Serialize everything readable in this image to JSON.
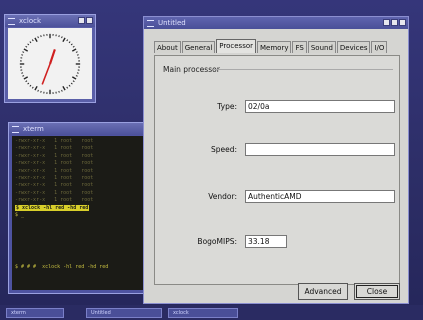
{
  "xclock": {
    "title": "xclock"
  },
  "xterm": {
    "title": "xterm",
    "lines": [
      "-rwxr-xr-x   1 root   root",
      "-rwxr-xr-x   1 root   root",
      "-rwxr-xr-x   1 root   root",
      "-rwxr-xr-x   1 root   root",
      "-rwxr-xr-x   1 root   root",
      "-rwxr-xr-x   1 root   root",
      "-rwxr-xr-x   1 root   root",
      "-rwxr-xr-x   1 root   root",
      "-rwxr-xr-x   1 root   root"
    ],
    "command": "$ xclock -hl red -hd red",
    "cursor": "$ _",
    "bottom_line": "$ # # #  xclock -hl red -hd red"
  },
  "dialog": {
    "title": "Untitled",
    "tabs": [
      "About",
      "General",
      "Processor",
      "Memory",
      "FS",
      "Sound",
      "Devices",
      "I/O"
    ],
    "active_tab": "Processor",
    "group_title": "Main processor",
    "fields": [
      {
        "label": "Type:",
        "value": "02/0a"
      },
      {
        "label": "Speed:",
        "value": ""
      },
      {
        "label": "Vendor:",
        "value": "AuthenticAMD"
      },
      {
        "label": "BogoMIPS:",
        "value": "33.18"
      }
    ],
    "buttons": {
      "advanced": "Advanced",
      "close": "Close"
    }
  },
  "taskbar": {
    "items": [
      "xterm",
      "Untitled",
      "xclock"
    ]
  },
  "colors": {
    "desktop": "#2e2f68",
    "titlebar": "#5f64ae",
    "terminal_bg": "#1b1b16",
    "highlight": "#d8cf2a",
    "clock_hand": "#d02020"
  },
  "icons": [
    "window-menu-icon",
    "minimize-icon",
    "maximize-icon",
    "close-icon"
  ]
}
